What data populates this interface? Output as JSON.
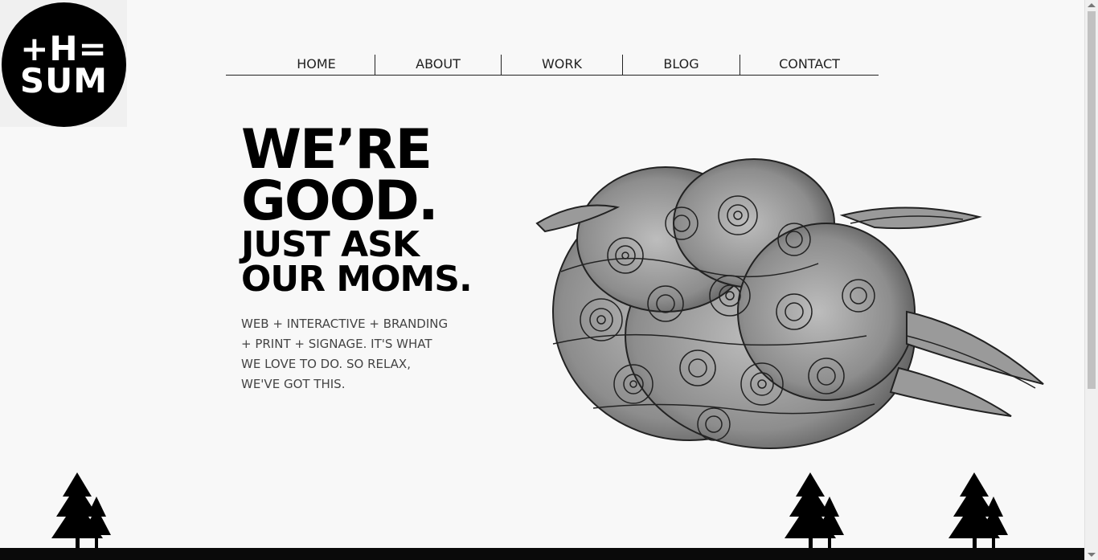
{
  "logo": {
    "line1": "+H=",
    "line2": "SUM"
  },
  "nav": {
    "items": [
      {
        "label": "HOME"
      },
      {
        "label": "ABOUT"
      },
      {
        "label": "WORK"
      },
      {
        "label": "BLOG"
      },
      {
        "label": "CONTACT"
      }
    ]
  },
  "hero": {
    "headline_line1": "WE’RE",
    "headline_line2": "GOOD.",
    "headline_line3": "JUST ASK",
    "headline_line4": "OUR MOMS.",
    "tagline_line1": "WEB + INTERACTIVE + BRANDING",
    "tagline_line2": "+ PRINT + SIGNAGE. IT'S WHAT",
    "tagline_line3": "WE LOVE TO DO. SO RELAX,",
    "tagline_line4": "WE'VE GOT THIS."
  },
  "colors": {
    "background": "#f8f8f8",
    "text": "#000000",
    "accent": "#000000"
  },
  "icons": {
    "cloud": "cloud-illustration",
    "tree": "pine-tree-icon"
  }
}
